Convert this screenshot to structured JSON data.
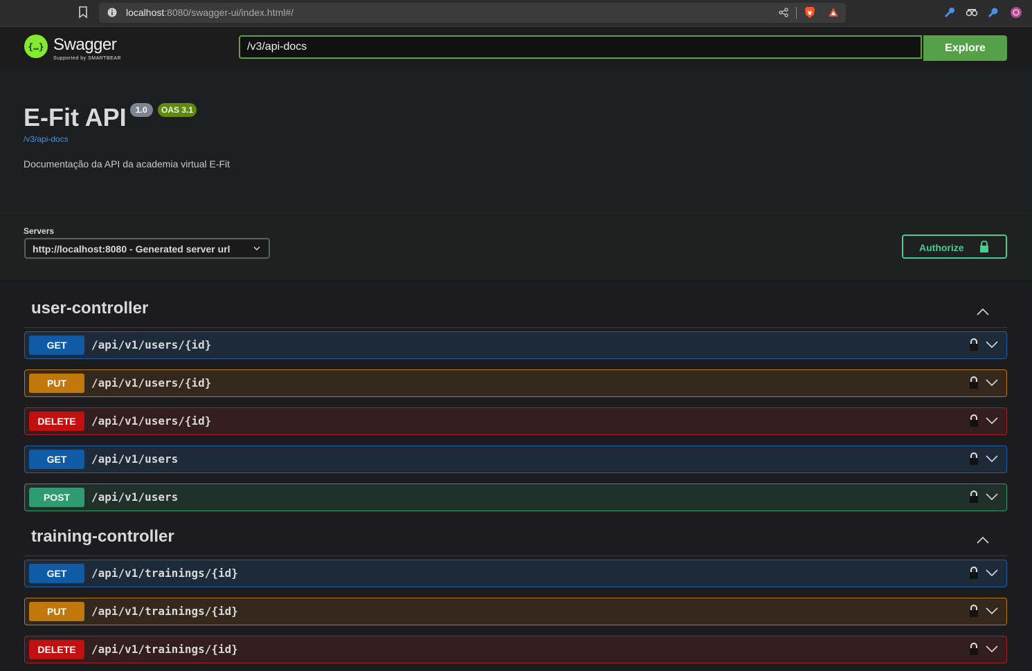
{
  "browser": {
    "url_host": "localhost",
    "url_rest": ":8080/swagger-ui/index.html#/"
  },
  "topbar": {
    "logo_text": "Swagger",
    "logo_subtext": "Supported by SMARTBEAR",
    "spec_url": "/v3/api-docs",
    "explore_label": "Explore"
  },
  "info": {
    "title": "E-Fit API",
    "version": "1.0",
    "oas": "OAS 3.1",
    "spec_link": "/v3/api-docs",
    "description": "Documentação da API da academia virtual E-Fit"
  },
  "servers": {
    "label": "Servers",
    "selected": "http://localhost:8080 - Generated server url"
  },
  "authorize_label": "Authorize",
  "tags": [
    {
      "name": "user-controller",
      "operations": [
        {
          "method": "GET",
          "path": "/api/v1/users/{id}"
        },
        {
          "method": "PUT",
          "path": "/api/v1/users/{id}"
        },
        {
          "method": "DELETE",
          "path": "/api/v1/users/{id}"
        },
        {
          "method": "GET",
          "path": "/api/v1/users"
        },
        {
          "method": "POST",
          "path": "/api/v1/users"
        }
      ]
    },
    {
      "name": "training-controller",
      "operations": [
        {
          "method": "GET",
          "path": "/api/v1/trainings/{id}"
        },
        {
          "method": "PUT",
          "path": "/api/v1/trainings/{id}"
        },
        {
          "method": "DELETE",
          "path": "/api/v1/trainings/{id}"
        }
      ]
    }
  ],
  "colors": {
    "get": "#0f5ba6",
    "put": "#c0780c",
    "delete": "#c20f0f",
    "post": "#2e9c70",
    "accent": "#49cc90",
    "explore": "#55a049"
  }
}
